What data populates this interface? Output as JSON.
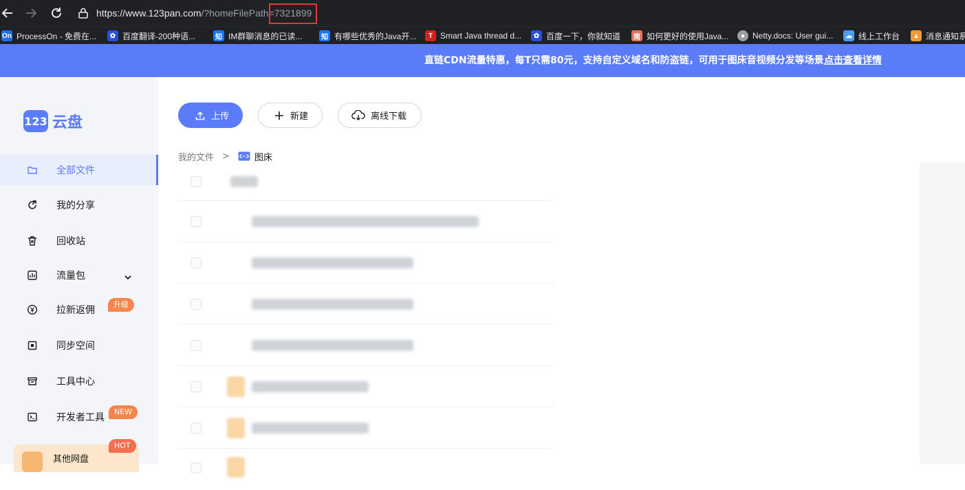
{
  "browser": {
    "url_host": "https://www.123pan.com",
    "url_path": "/?homeFilePath",
    "url_highlighted": "=7321899",
    "bookmarks": [
      {
        "label": "ProcessOn - 免费在...",
        "icon": "processon-icon",
        "color": "#1e6ee8",
        "glyph": "On"
      },
      {
        "label": "百度翻译-200种语...",
        "icon": "baidu-paw-icon",
        "color": "#2d4ed8",
        "glyph": "🐾"
      },
      {
        "label": "IM群聊消息的已读...",
        "icon": "zhihu-icon",
        "color": "#1677ff",
        "glyph": "知"
      },
      {
        "label": "有哪些优秀的Java开...",
        "icon": "zhihu-icon",
        "color": "#1677ff",
        "glyph": "知"
      },
      {
        "label": "Smart Java thread d...",
        "icon": "red-t-icon",
        "color": "#d6201e",
        "glyph": "T"
      },
      {
        "label": "百度一下，你就知道",
        "icon": "baidu-paw-icon",
        "color": "#2d4ed8",
        "glyph": "🐾"
      },
      {
        "label": "如何更好的使用Java...",
        "icon": "jianshu-icon",
        "color": "#ea6f5a",
        "glyph": "简"
      },
      {
        "label": "Netty.docs: User gui...",
        "icon": "github-icon",
        "color": "#9aa0a6",
        "glyph": "●"
      },
      {
        "label": "线上工作台",
        "icon": "cloud-icon",
        "color": "#4a9ef0",
        "glyph": "☁"
      },
      {
        "label": "消息通知系",
        "icon": "doc-icon",
        "color": "#f29b38",
        "glyph": "▲"
      }
    ]
  },
  "banner": {
    "text": "直链CDN流量特惠，每T只需80元，支持自定义域名和防盗链，可用于图床音视频分发等场景",
    "link": "点击查看详情"
  },
  "sidebar": {
    "logo_mark": "123",
    "logo_text": "云盘",
    "items": [
      {
        "label": "全部文件",
        "icon": "folder-icon",
        "active": true
      },
      {
        "label": "我的分享",
        "icon": "share-icon"
      },
      {
        "label": "回收站",
        "icon": "trash-icon"
      },
      {
        "label": "流量包",
        "icon": "chart-icon"
      },
      {
        "label": "拉新返佣",
        "icon": "yuan-icon",
        "tag": "升级"
      },
      {
        "label": "同步空间",
        "icon": "sync-icon"
      },
      {
        "label": "工具中心",
        "icon": "toolbox-icon"
      },
      {
        "label": "开发者工具",
        "icon": "terminal-icon",
        "tag": "NEW"
      }
    ],
    "promo": {
      "label": "其他网盘",
      "tag": "HOT"
    }
  },
  "toolbar": {
    "upload_label": "上传",
    "new_label": "新建",
    "offline_download_label": "离线下载"
  },
  "breadcrumb": {
    "root": "我的文件",
    "separator": ">",
    "current": "图床"
  }
}
